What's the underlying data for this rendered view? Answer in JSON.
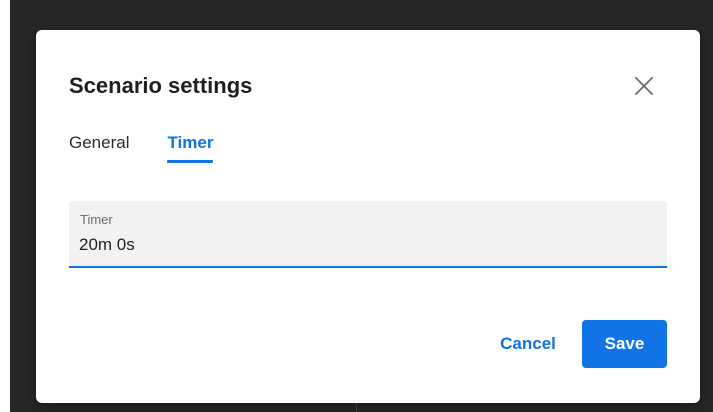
{
  "dialog": {
    "title": "Scenario settings",
    "close_icon": "close-icon"
  },
  "tabs": [
    {
      "label": "General",
      "active": false
    },
    {
      "label": "Timer",
      "active": true
    }
  ],
  "timer_field": {
    "label": "Timer",
    "value": "20m 0s"
  },
  "actions": {
    "cancel_label": "Cancel",
    "save_label": "Save"
  },
  "colors": {
    "accent": "#1174e6",
    "dialog_background": "#ffffff",
    "field_background": "#f2f2f2",
    "backdrop": "#272727"
  }
}
